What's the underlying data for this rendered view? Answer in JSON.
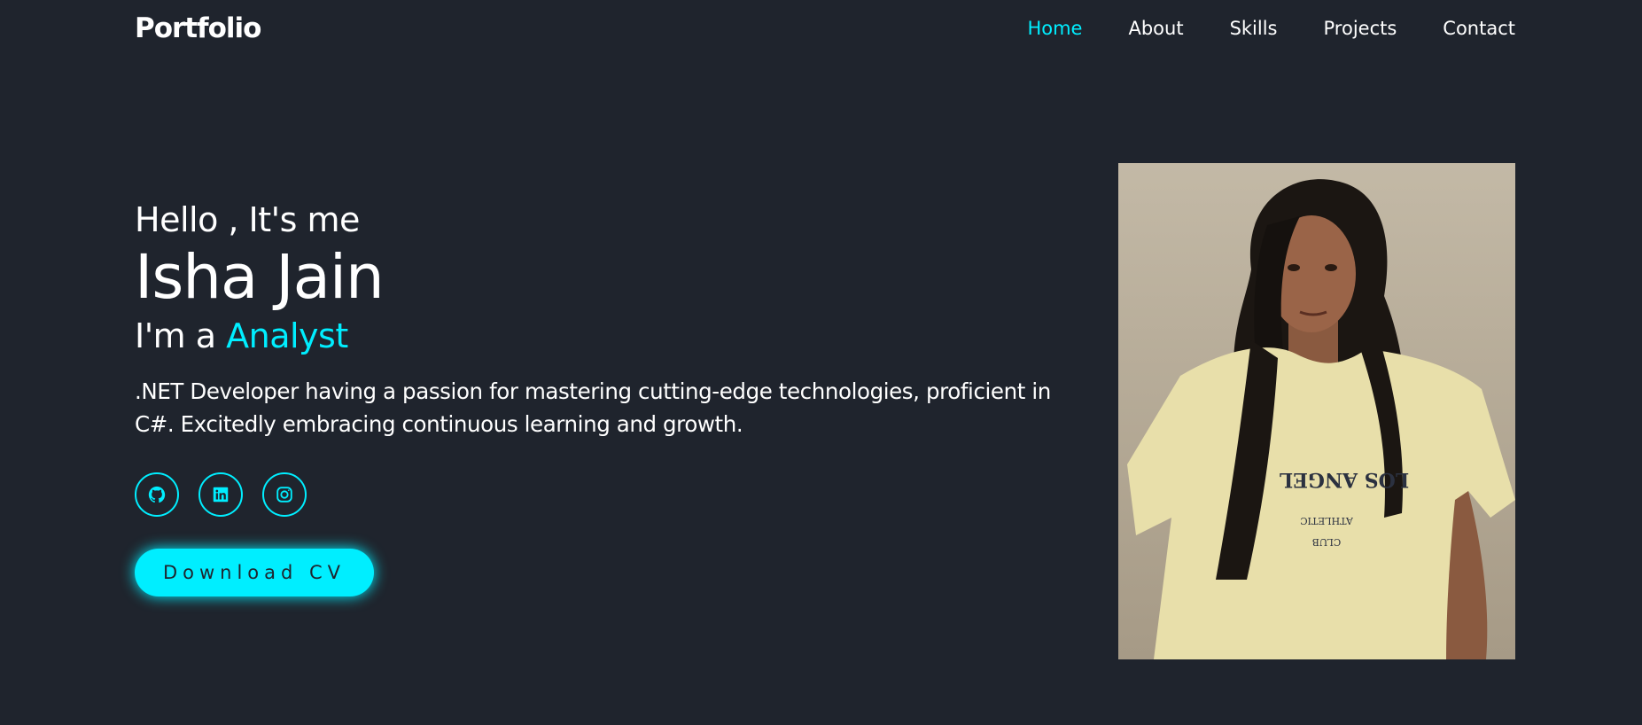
{
  "header": {
    "logo": "Portfolio",
    "nav": [
      {
        "label": "Home",
        "active": true
      },
      {
        "label": "About",
        "active": false
      },
      {
        "label": "Skills",
        "active": false
      },
      {
        "label": "Projects",
        "active": false
      },
      {
        "label": "Contact",
        "active": false
      }
    ]
  },
  "hero": {
    "greeting": "Hello , It's me",
    "name": "Isha Jain",
    "role_prefix": "I'm a ",
    "role": "Analyst",
    "bio": ".NET Developer having a passion for mastering cutting-edge technologies, proficient in C#. Excitedly embracing continuous learning and growth.",
    "socials": [
      {
        "icon": "github-icon"
      },
      {
        "icon": "linkedin-icon"
      },
      {
        "icon": "instagram-icon"
      }
    ],
    "cv_button": "Download CV"
  },
  "photo": {
    "shirt_text_line1": "LOS ANGEL",
    "shirt_text_line2": "ATHLETIC",
    "shirt_text_line3": "CLUB"
  },
  "colors": {
    "background": "#1f242d",
    "accent": "#00eeff",
    "text": "#ffffff"
  }
}
